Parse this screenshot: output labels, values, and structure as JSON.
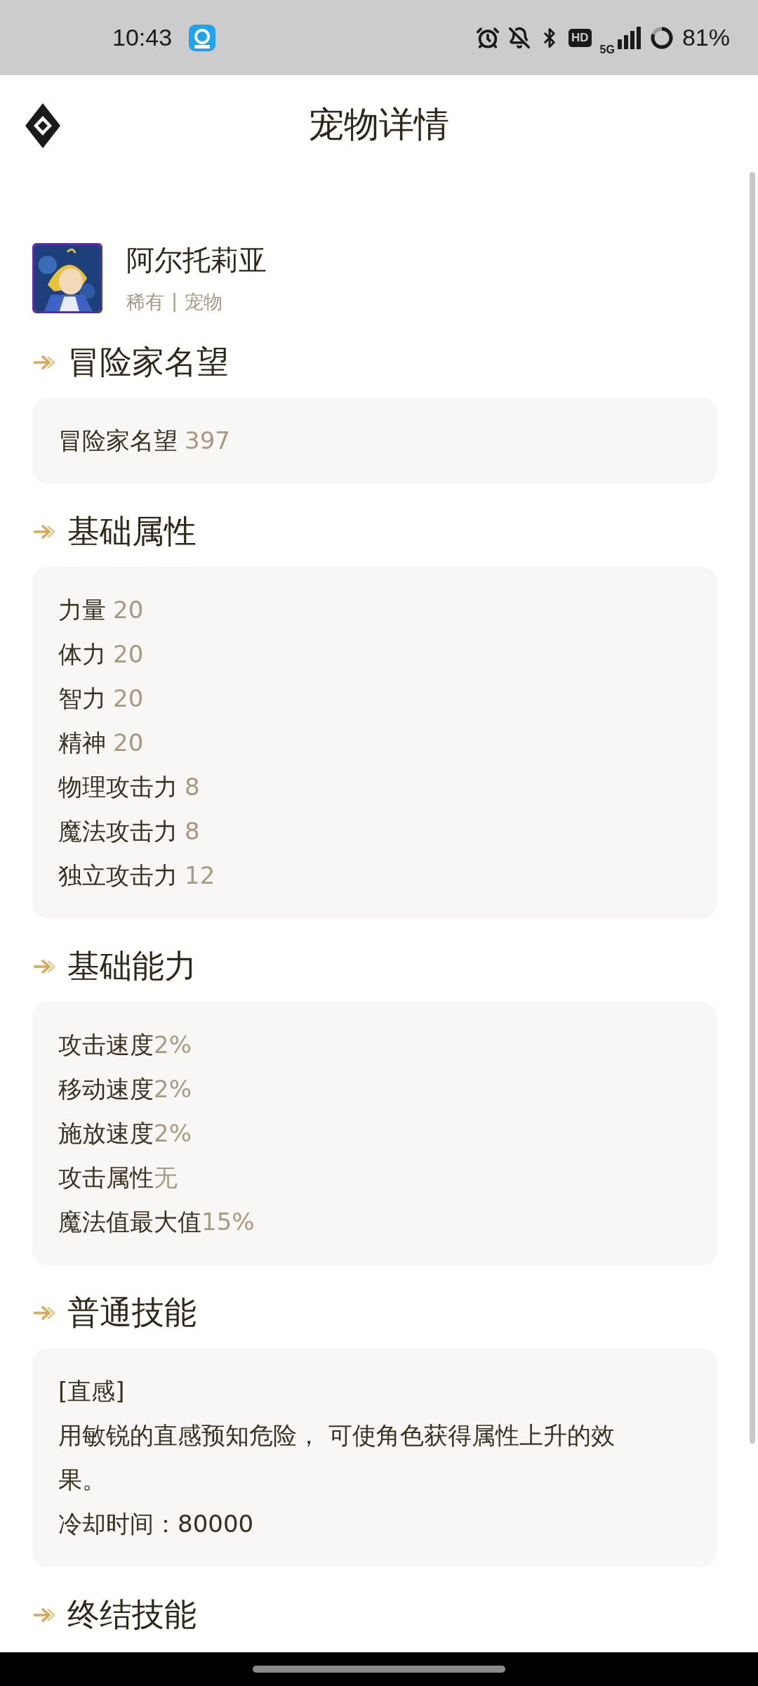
{
  "status_bar": {
    "time": "10:43",
    "hd_badge": "HD",
    "network_type": "5G",
    "battery": "81%"
  },
  "header": {
    "title": "宠物详情"
  },
  "pet": {
    "name": "阿尔托莉亚",
    "rarity": "稀有",
    "separator": "|",
    "category": "宠物"
  },
  "sections": [
    {
      "title": "冒险家名望",
      "kind": "stats",
      "rows": [
        {
          "label": "冒险家名望",
          "value": "397",
          "separated": true
        }
      ]
    },
    {
      "title": "基础属性",
      "kind": "stats",
      "rows": [
        {
          "label": "力量",
          "value": "20",
          "separated": true
        },
        {
          "label": "体力",
          "value": "20",
          "separated": true
        },
        {
          "label": "智力",
          "value": "20",
          "separated": true
        },
        {
          "label": "精神",
          "value": "20",
          "separated": true
        },
        {
          "label": "物理攻击力",
          "value": "8",
          "separated": true
        },
        {
          "label": "魔法攻击力",
          "value": "8",
          "separated": true
        },
        {
          "label": "独立攻击力",
          "value": "12",
          "separated": true
        }
      ]
    },
    {
      "title": "基础能力",
      "kind": "stats",
      "rows": [
        {
          "label": "攻击速度",
          "value": "2%",
          "separated": false
        },
        {
          "label": "移动速度",
          "value": "2%",
          "separated": false
        },
        {
          "label": "施放速度",
          "value": "2%",
          "separated": false
        },
        {
          "label": "攻击属性",
          "value": "无",
          "separated": false
        },
        {
          "label": "魔法值最大值",
          "value": "15%",
          "separated": false
        }
      ]
    },
    {
      "title": "普通技能",
      "kind": "skill",
      "skill": {
        "name": "[直感]",
        "description": "用敏锐的直感预知危险， 可使角色获得属性上升的效果。",
        "cooldown": "冷却时间：80000"
      }
    },
    {
      "title": "终结技能",
      "kind": "title_only"
    }
  ]
}
